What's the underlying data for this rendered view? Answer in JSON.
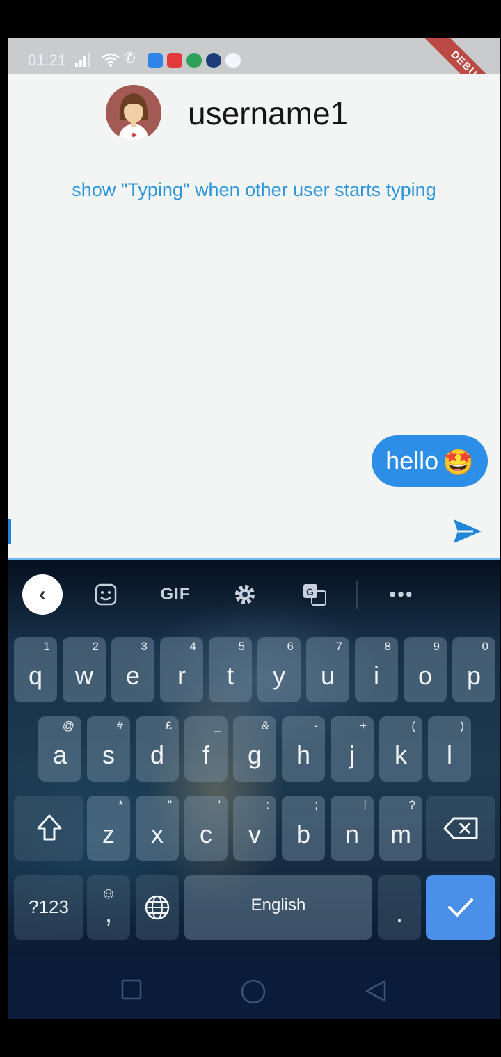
{
  "status_bar": {
    "time": "01:21"
  },
  "debug_banner": {
    "label": "DEBUG"
  },
  "chat": {
    "title": "username1",
    "typing_hint": "show \"Typing\" when other user starts typing",
    "message": {
      "text": "hello",
      "emoji": "🤩"
    },
    "input_value": ""
  },
  "keyboard": {
    "toolbar": {
      "collapse": "‹",
      "gif": "GIF",
      "more": "•••"
    },
    "row1": [
      {
        "key": "q",
        "hint": "1"
      },
      {
        "key": "w",
        "hint": "2"
      },
      {
        "key": "e",
        "hint": "3"
      },
      {
        "key": "r",
        "hint": "4"
      },
      {
        "key": "t",
        "hint": "5"
      },
      {
        "key": "y",
        "hint": "6"
      },
      {
        "key": "u",
        "hint": "7"
      },
      {
        "key": "i",
        "hint": "8"
      },
      {
        "key": "o",
        "hint": "9"
      },
      {
        "key": "p",
        "hint": "0"
      }
    ],
    "row2": [
      {
        "key": "a",
        "hint": "@"
      },
      {
        "key": "s",
        "hint": "#"
      },
      {
        "key": "d",
        "hint": "£"
      },
      {
        "key": "f",
        "hint": "_"
      },
      {
        "key": "g",
        "hint": "&"
      },
      {
        "key": "h",
        "hint": "-"
      },
      {
        "key": "j",
        "hint": "+"
      },
      {
        "key": "k",
        "hint": "("
      },
      {
        "key": "l",
        "hint": ")"
      }
    ],
    "row3": [
      {
        "key": "z",
        "hint": "*"
      },
      {
        "key": "x",
        "hint": "\""
      },
      {
        "key": "c",
        "hint": "'"
      },
      {
        "key": "v",
        "hint": ":"
      },
      {
        "key": "b",
        "hint": ";"
      },
      {
        "key": "n",
        "hint": "!"
      },
      {
        "key": "m",
        "hint": "?"
      }
    ],
    "bottom": {
      "symbols": "?123",
      "comma": ",",
      "comma_hint": "☺",
      "space": "English",
      "period": "."
    }
  },
  "colors": {
    "accent": "#2c8ee6",
    "hint_text": "#2d95db",
    "enter_key": "#4a8fe8",
    "debug": "#b8342c"
  },
  "icons": [
    "signal-icon",
    "wifi-icon",
    "call-icon",
    "send-icon",
    "sticker-icon",
    "settings-icon",
    "translate-icon",
    "shift-icon",
    "backspace-icon",
    "globe-icon",
    "check-icon",
    "home-icon",
    "recents-icon",
    "back-icon"
  ]
}
